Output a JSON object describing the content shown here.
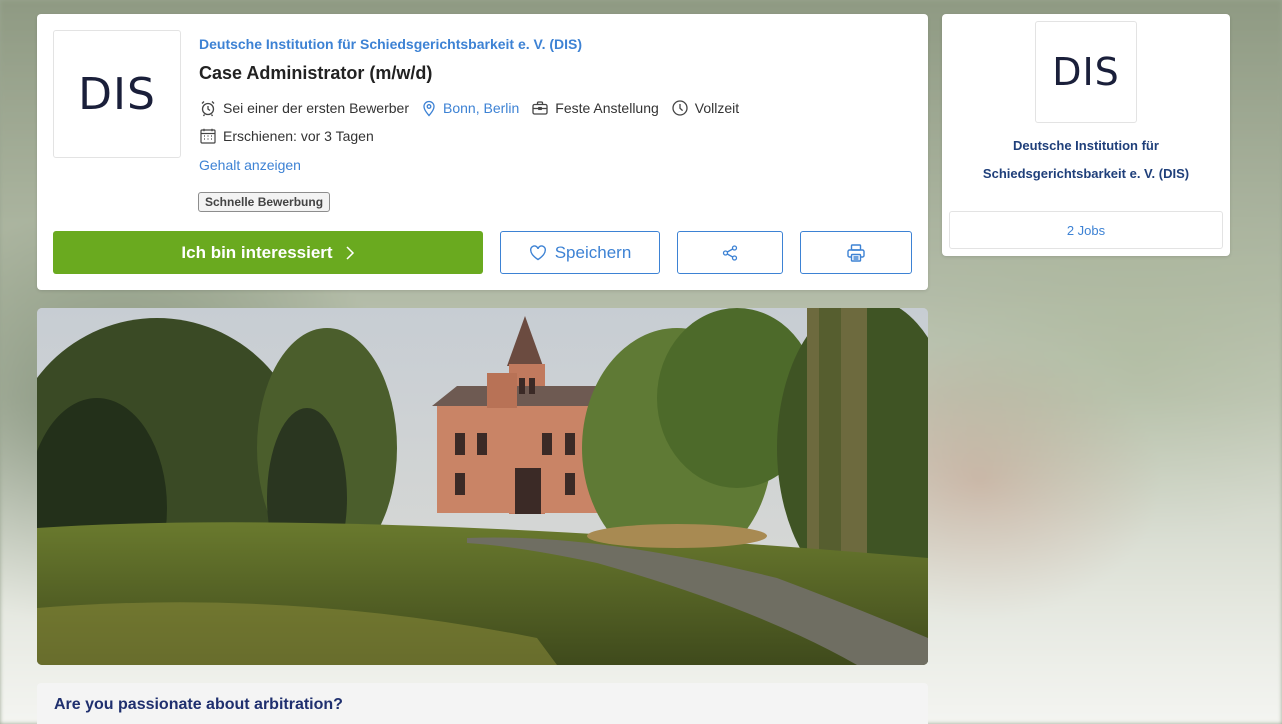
{
  "job": {
    "company": "Deutsche Institution für Schiedsgerichtsbarkeit e. V. (DIS)",
    "title": "Case Administrator (m/w/d)",
    "logo_text": "DIS",
    "early_applicant": "Sei einer der ersten Bewerber",
    "location": "Bonn, Berlin",
    "employment_type": "Feste Anstellung",
    "work_time": "Vollzeit",
    "published": "Erschienen: vor 3 Tagen",
    "salary_link": "Gehalt anzeigen",
    "badge": "Schnelle Bewerbung"
  },
  "actions": {
    "interested_label": "Ich bin interessiert",
    "save_label": "Speichern"
  },
  "icons": {
    "early": "alarm-clock-icon",
    "location": "map-pin-icon",
    "employment": "briefcase-icon",
    "work_time": "clock-icon",
    "published": "calendar-icon",
    "chevron": "chevron-right-icon",
    "save": "heart-icon",
    "share": "share-icon",
    "print": "printer-icon"
  },
  "sidebar": {
    "logo_text": "DIS",
    "company_line1": "Deutsche Institution für",
    "company_line2": "Schiedsgerichtsbarkeit e. V. (DIS)",
    "jobs_label": "2 Jobs"
  },
  "section": {
    "title": "Are you passionate about arbitration?"
  },
  "colors": {
    "accent_blue": "#3d82d4",
    "primary_green": "#6aaa1f",
    "navy": "#1f2f6e"
  }
}
